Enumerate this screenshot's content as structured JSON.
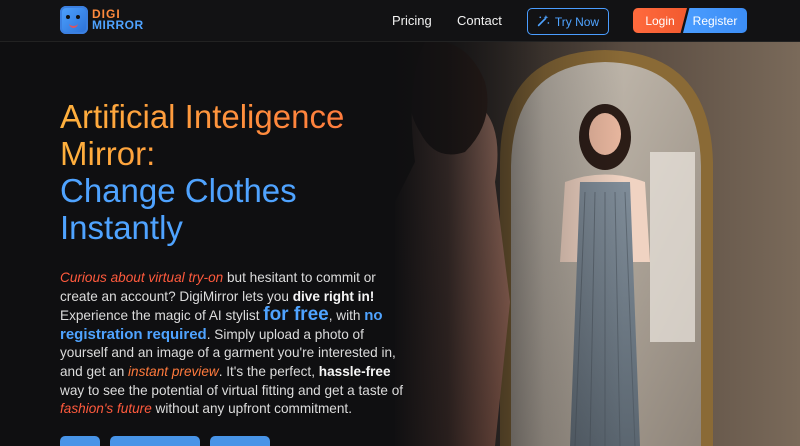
{
  "header": {
    "logo": {
      "line1": "DIGI",
      "line2": "MIRROR",
      "icon": "mirror-face-icon"
    },
    "nav": {
      "pricing": "Pricing",
      "contact": "Contact"
    },
    "try_now": {
      "label": "Try Now",
      "icon": "magic-wand-icon"
    },
    "login": "Login",
    "register": "Register"
  },
  "hero": {
    "title_line1": "Artificial Inteligence",
    "title_line2": "Mirror:",
    "title_line3": "Change Clothes",
    "title_line4": "Instantly",
    "desc": {
      "p1": "Curious about virtual try-on",
      "p2": " but hesitant to commit or create an account? DigiMirror lets you ",
      "p3": "dive right in!",
      "p4": " Experience the magic of AI stylist ",
      "p5": "for free",
      "p6": ", with ",
      "p7": "no registration required",
      "p8": ". Simply upload a photo of yourself and an image of a garment you're interested in, and get an ",
      "p9": "instant preview",
      "p10": ". It's the perfect, ",
      "p11": "hassle-free",
      "p12": " way to see the potential of virtual fitting and get a taste of ",
      "p13": "fashion's future",
      "p14": " without any upfront commitment."
    }
  },
  "colors": {
    "orange": "#ff6a3d",
    "blue": "#4fa3ff",
    "background": "#0f0f11"
  }
}
